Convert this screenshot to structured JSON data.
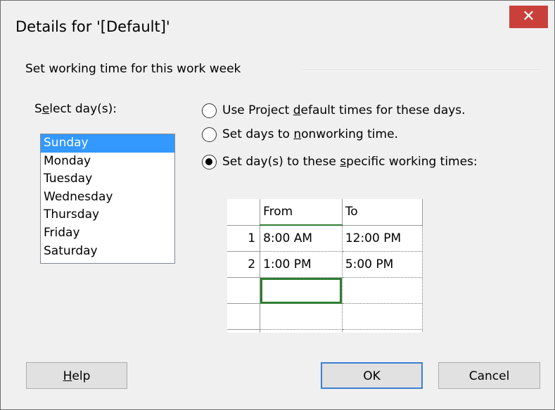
{
  "window": {
    "title": "Details for '[Default]'",
    "close_glyph": "✕"
  },
  "group": {
    "label": "Set working time for this work week"
  },
  "days": {
    "label_pre": "S",
    "label_ul": "e",
    "label_post": "lect day(s):",
    "items": [
      "Sunday",
      "Monday",
      "Tuesday",
      "Wednesday",
      "Thursday",
      "Friday",
      "Saturday"
    ],
    "selected": "Sunday"
  },
  "options": {
    "default_times": {
      "pre": "Use Project ",
      "ul": "d",
      "post": "efault times for these days.",
      "checked": false
    },
    "nonworking": {
      "pre": "Set days to ",
      "ul": "n",
      "post": "onworking time.",
      "checked": false
    },
    "specific": {
      "pre": "Set day(s) to these ",
      "ul": "s",
      "post": "pecific working times:",
      "checked": true
    }
  },
  "times_grid": {
    "headers": {
      "from": "From",
      "to": "To"
    },
    "rows": [
      {
        "num": "1",
        "from": "8:00 AM",
        "to": "12:00 PM"
      },
      {
        "num": "2",
        "from": "1:00 PM",
        "to": "5:00 PM"
      },
      {
        "num": "",
        "from": "",
        "to": ""
      },
      {
        "num": "",
        "from": "",
        "to": ""
      },
      {
        "num": "",
        "from": "",
        "to": ""
      }
    ]
  },
  "buttons": {
    "help_ul": "H",
    "help_post": "elp",
    "ok": "OK",
    "cancel": "Cancel"
  },
  "colors": {
    "accent_selection": "#3399ff",
    "close_button": "#c9403a",
    "active_cell": "#2e7d32"
  }
}
